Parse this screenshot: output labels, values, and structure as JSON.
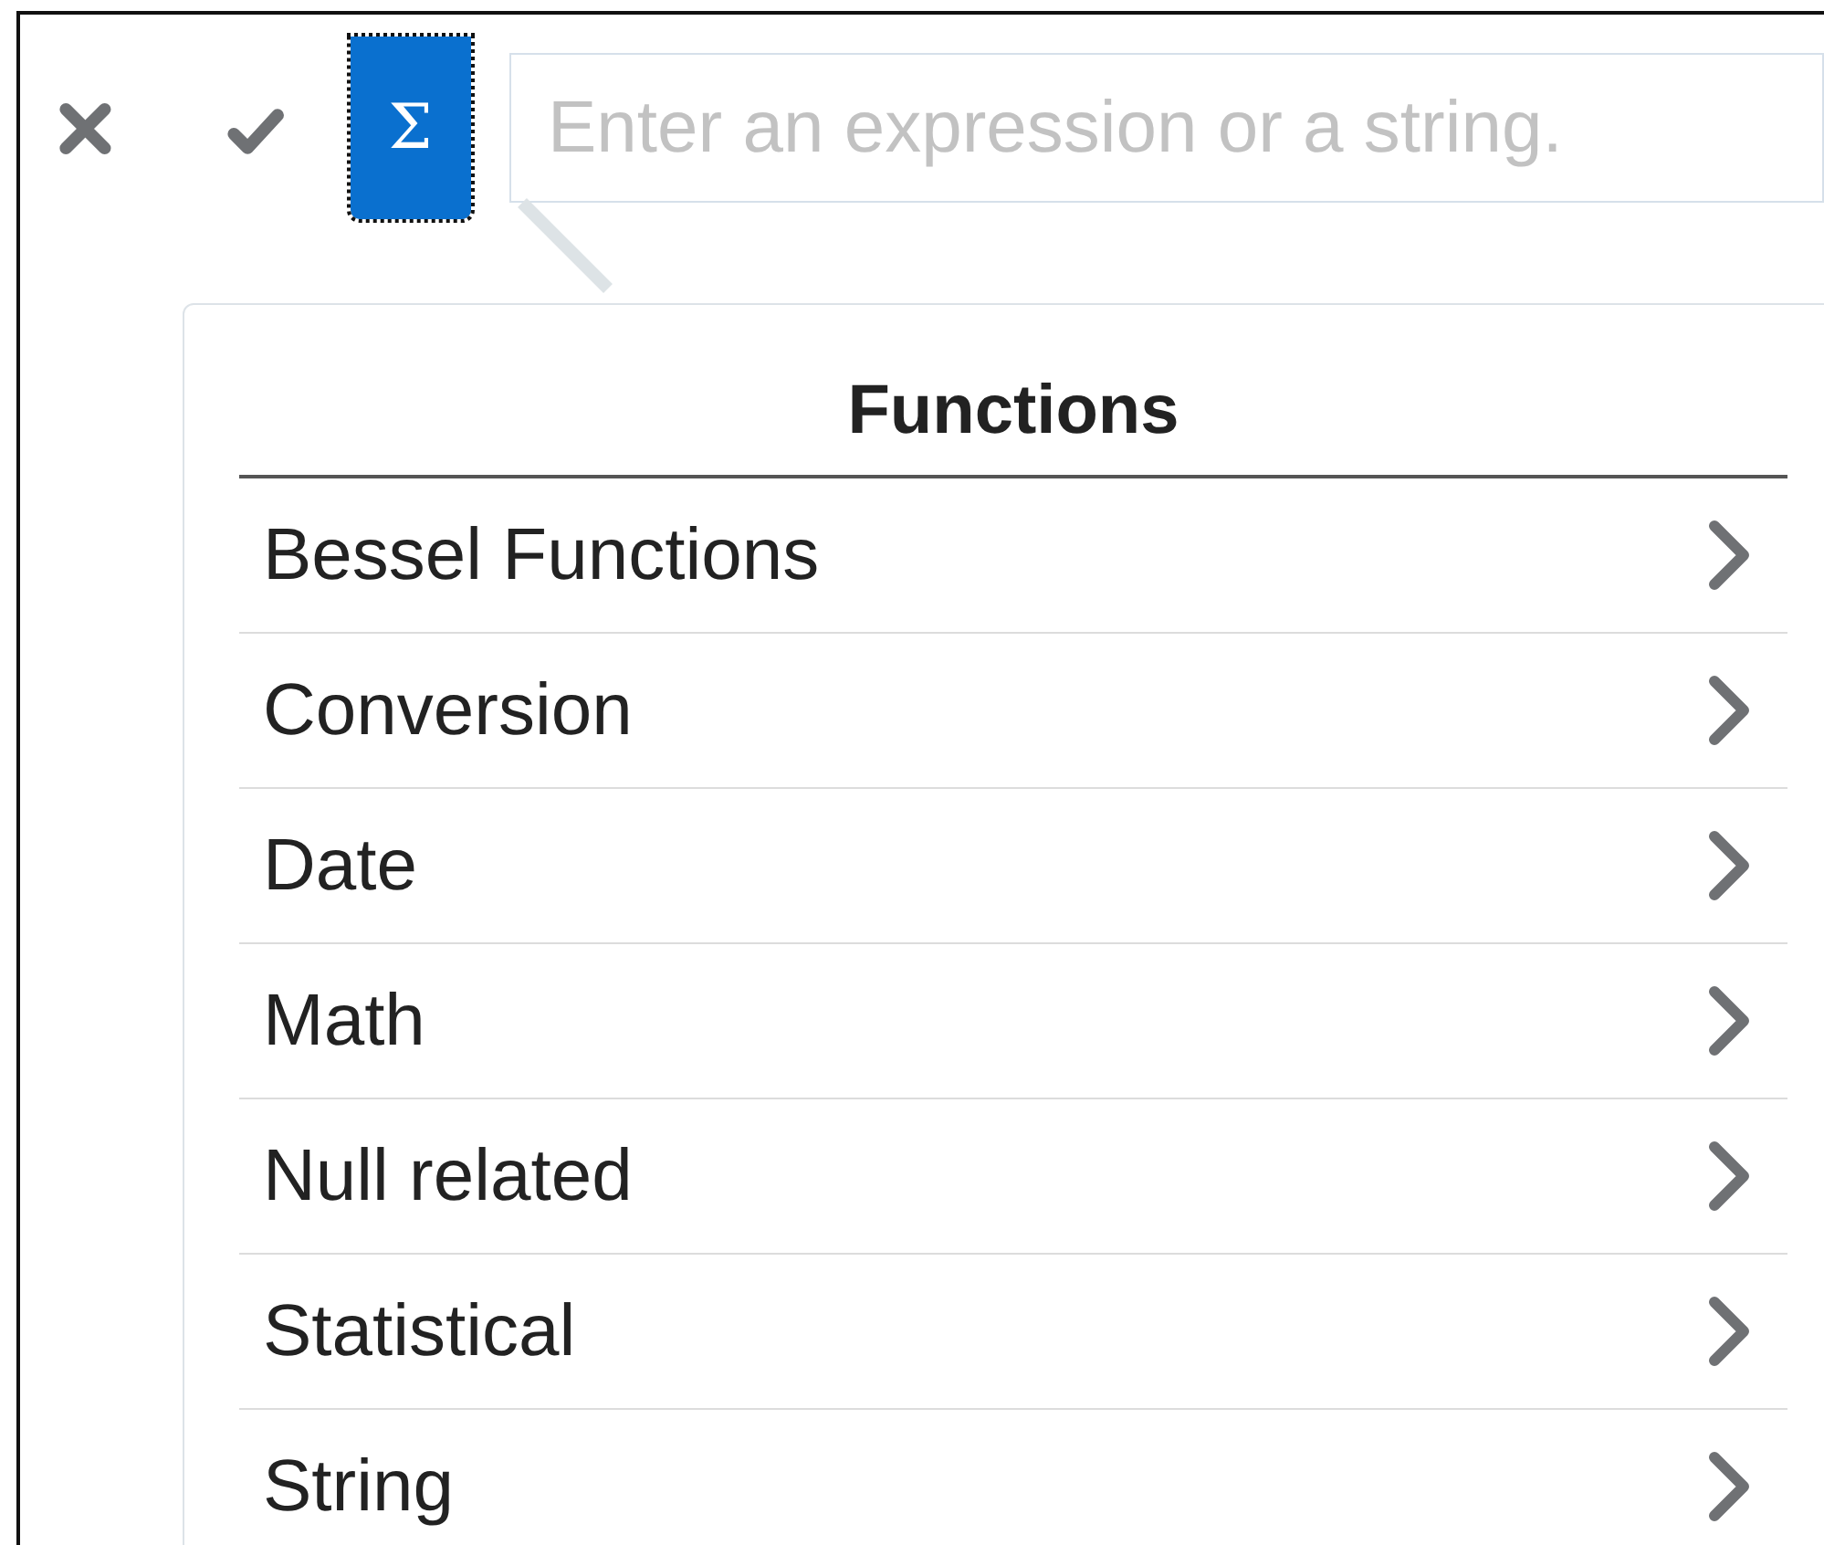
{
  "toolbar": {
    "buttons": [
      {
        "kind": "cancel"
      },
      {
        "kind": "accept"
      },
      {
        "kind": "functions",
        "label": "Σ",
        "focused": true
      }
    ],
    "expression_field": {
      "placeholder": "Enter an expression or a string."
    }
  },
  "functions_popup": {
    "title": "Functions",
    "items": [
      {
        "label": "Bessel Functions"
      },
      {
        "label": "Conversion"
      },
      {
        "label": "Date"
      },
      {
        "label": "Math"
      },
      {
        "label": "Null related"
      },
      {
        "label": "Statistical"
      },
      {
        "label": "String"
      }
    ]
  }
}
